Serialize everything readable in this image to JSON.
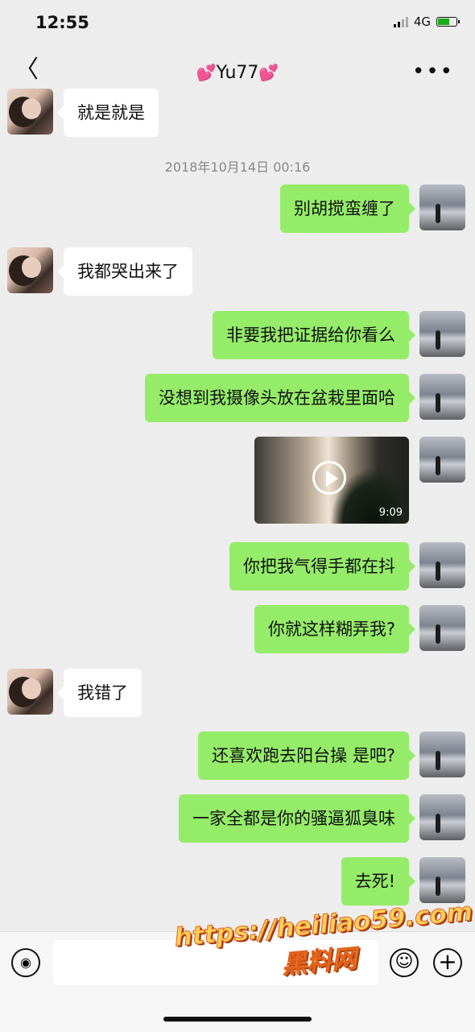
{
  "status_bar": {
    "time": "12:55",
    "network": "4G"
  },
  "header": {
    "back": "〈",
    "title_prefix": "💕",
    "title": "Yu77",
    "title_suffix": "💕",
    "more": "•••"
  },
  "timestamp": "2018年10月14日 00:16",
  "messages": [
    {
      "side": "left",
      "text": "就是就是"
    },
    {
      "side": "right",
      "text": "别胡搅蛮缠了"
    },
    {
      "side": "left",
      "text": "我都哭出来了"
    },
    {
      "side": "right",
      "text": "非要我把证据给你看么"
    },
    {
      "side": "right",
      "text": "没想到我摄像头放在盆栽里面哈"
    },
    {
      "side": "right",
      "type": "video",
      "duration": "9:09"
    },
    {
      "side": "right",
      "text": "你把我气得手都在抖"
    },
    {
      "side": "right",
      "text": "你就这样糊弄我?"
    },
    {
      "side": "left",
      "text": "我错了"
    },
    {
      "side": "right",
      "text": "还喜欢跑去阳台操 是吧?"
    },
    {
      "side": "right",
      "text": "一家全都是你的骚逼狐臭味"
    },
    {
      "side": "right",
      "text": "去死!"
    }
  ],
  "input_bar": {
    "voice_icon": "voice-icon",
    "emoji_icon": "emoji-icon",
    "plus_icon": "plus-icon",
    "placeholder": ""
  },
  "watermark": {
    "line1": "https://heiliao59.com",
    "line2": "黑料网"
  }
}
